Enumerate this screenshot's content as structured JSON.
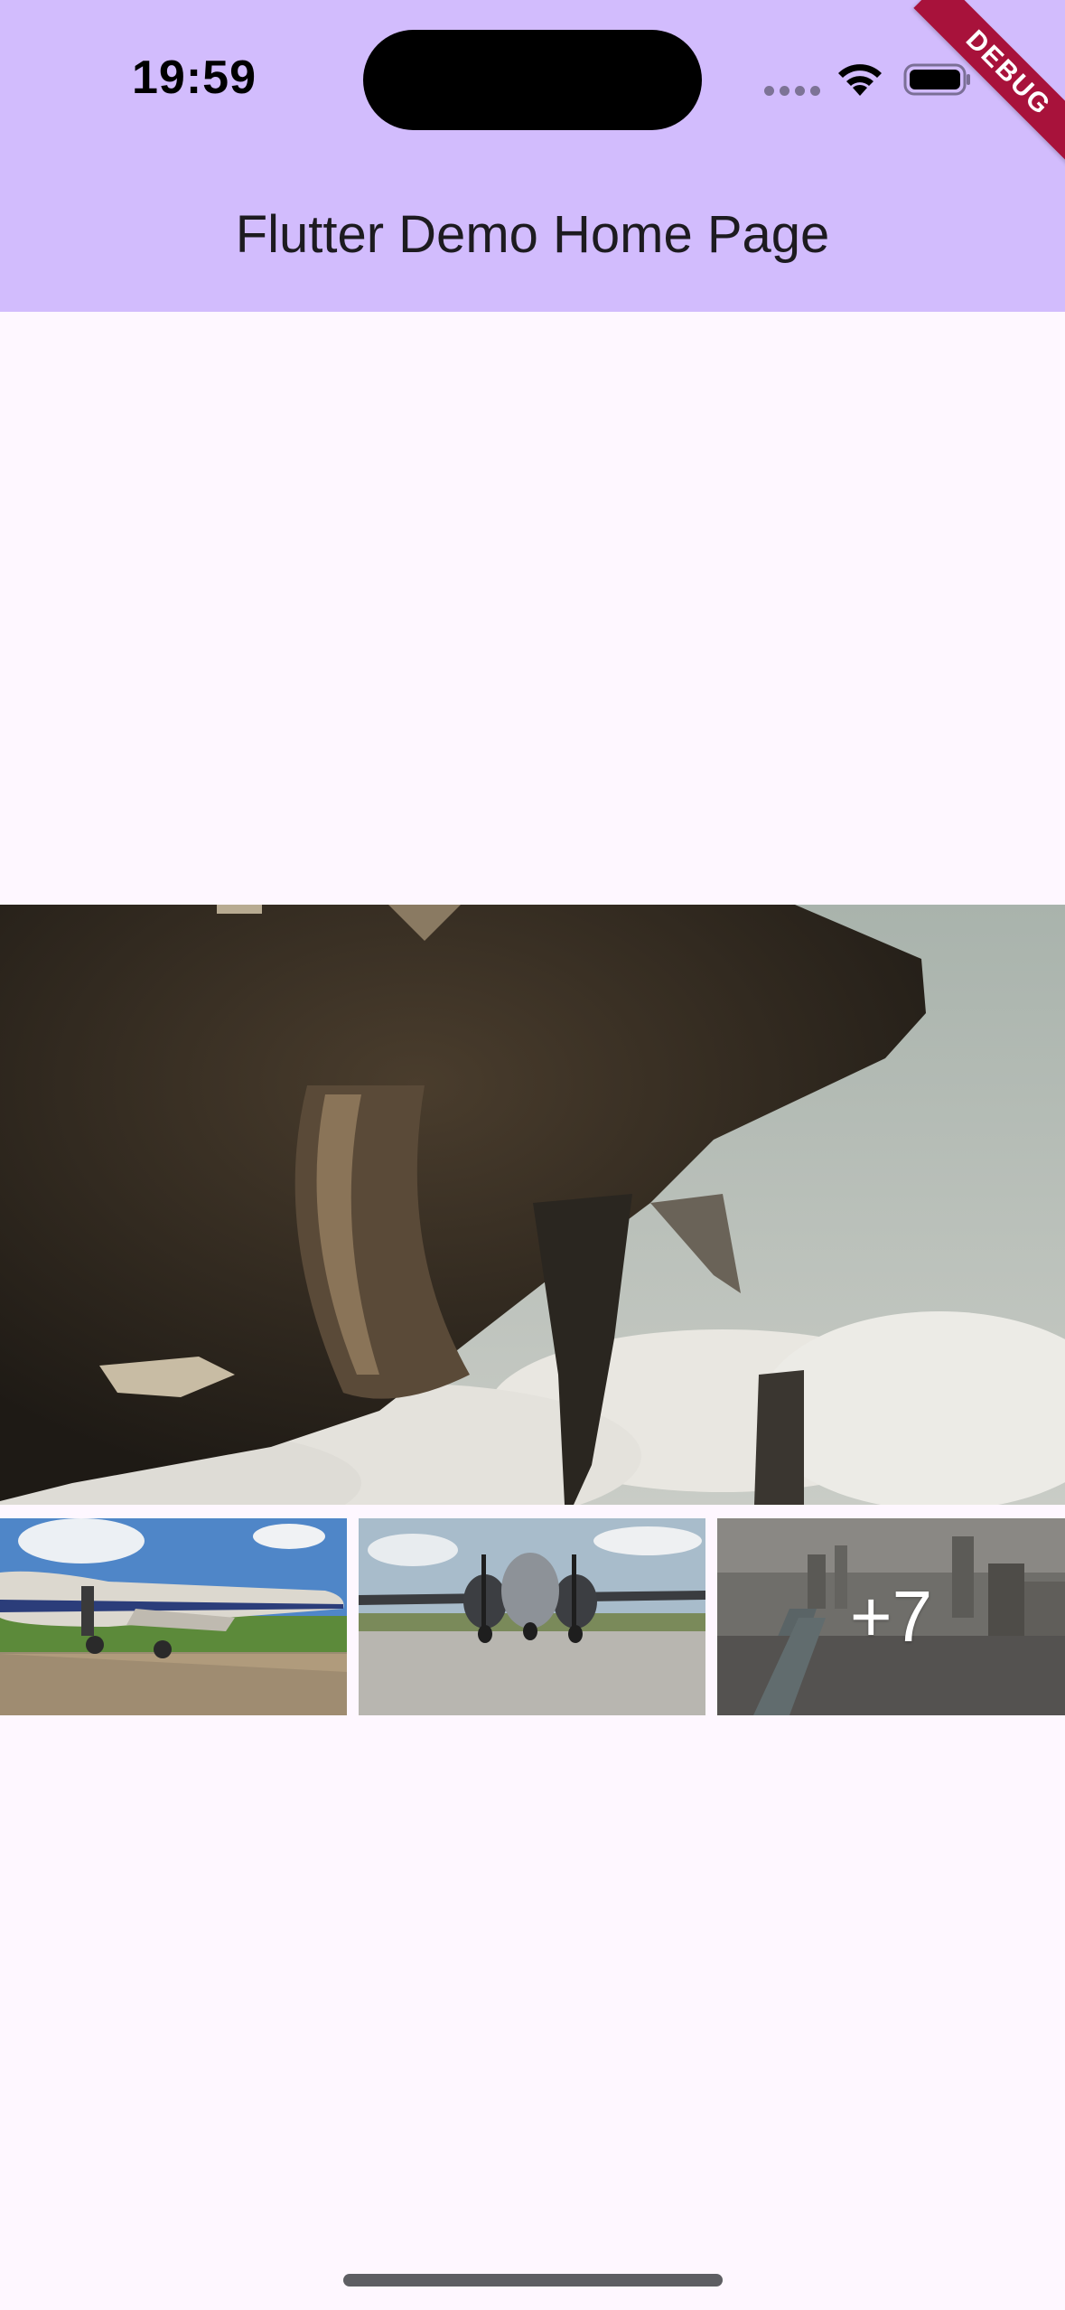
{
  "status_bar": {
    "time": "19:59",
    "icons": [
      "cellular-dots-icon",
      "wifi-icon",
      "battery-icon"
    ]
  },
  "debug_banner": "DEBUG",
  "app_bar": {
    "title": "Flutter Demo Home Page",
    "background_color": "#d2bcfd"
  },
  "gallery": {
    "main_image": "propeller-closeup-image",
    "thumbnails": [
      {
        "name": "vintage-airliner-image"
      },
      {
        "name": "twin-engine-bomber-image"
      },
      {
        "name": "city-river-image",
        "overlay_label": "+7"
      }
    ]
  },
  "colors": {
    "page_background": "#fef7ff",
    "title_text": "#1d1b20",
    "debug_ribbon": "#a8123b"
  }
}
